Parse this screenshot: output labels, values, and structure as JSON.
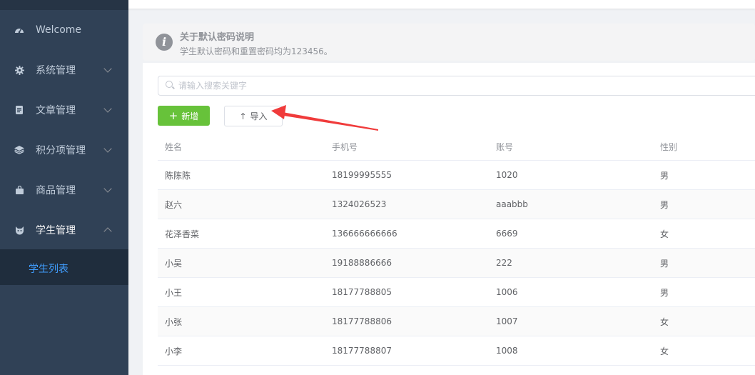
{
  "sidebar": {
    "items": [
      {
        "label": "Welcome",
        "icon": "dashboard-icon"
      },
      {
        "label": "系统管理",
        "icon": "gear-icon"
      },
      {
        "label": "文章管理",
        "icon": "document-icon"
      },
      {
        "label": "积分项管理",
        "icon": "layers-icon"
      },
      {
        "label": "商品管理",
        "icon": "bag-icon"
      },
      {
        "label": "学生管理",
        "icon": "student-icon"
      }
    ],
    "subitems": [
      {
        "label": "学生列表"
      }
    ]
  },
  "alert": {
    "title": "关于默认密码说明",
    "description": "学生默认密码和重置密码均为123456。",
    "icon": "info-icon"
  },
  "search": {
    "placeholder": "请输入搜索关键字",
    "value": ""
  },
  "toolbar": {
    "add_label": "新增",
    "import_label": "导入"
  },
  "colors": {
    "accent": "#409eff",
    "add": "#67c23a",
    "annotation_arrow": "#f03b3b"
  },
  "table": {
    "headers": [
      "姓名",
      "手机号",
      "账号",
      "性别"
    ],
    "rows": [
      [
        "陈陈陈",
        "18199995555",
        "1020",
        "男"
      ],
      [
        "赵六",
        "1324026523",
        "aaabbb",
        "男"
      ],
      [
        "花泽香菜",
        "136666666666",
        "6669",
        "女"
      ],
      [
        "小吴",
        "19188886666",
        "222",
        "男"
      ],
      [
        "小王",
        "18177788805",
        "1006",
        "男"
      ],
      [
        "小张",
        "18177788806",
        "1007",
        "女"
      ],
      [
        "小李",
        "18177788807",
        "1008",
        "女"
      ]
    ]
  }
}
